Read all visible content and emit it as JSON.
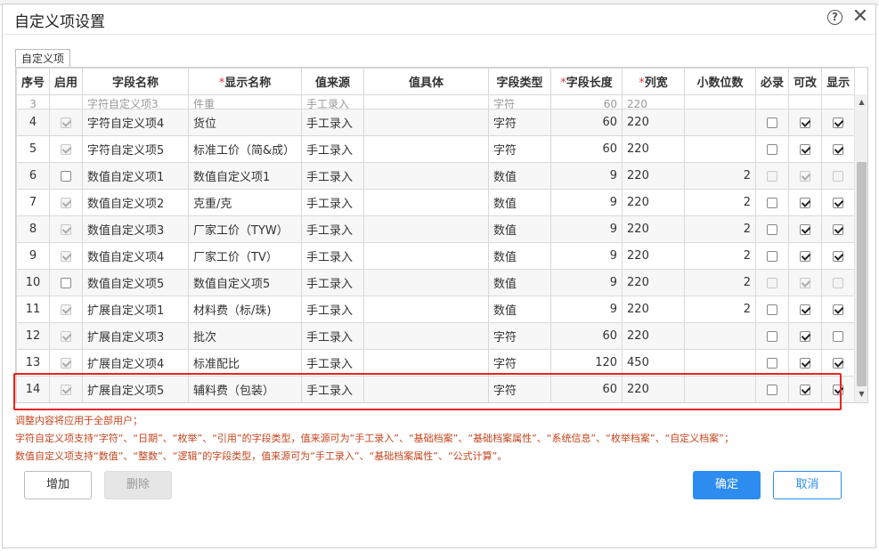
{
  "dialog": {
    "title": "自定义项设置",
    "tab": "自定义项"
  },
  "columns": [
    {
      "label": "序号",
      "required": false
    },
    {
      "label": "启用",
      "required": false
    },
    {
      "label": "字段名称",
      "required": false
    },
    {
      "label": "显示名称",
      "required": true
    },
    {
      "label": "值来源",
      "required": false
    },
    {
      "label": "值具体",
      "required": false
    },
    {
      "label": "字段类型",
      "required": false
    },
    {
      "label": "字段长度",
      "required": true
    },
    {
      "label": "列宽",
      "required": true
    },
    {
      "label": "小数位数",
      "required": false
    },
    {
      "label": "必录",
      "required": false
    },
    {
      "label": "可改",
      "required": false
    },
    {
      "label": "显示",
      "required": false
    }
  ],
  "partial_row": {
    "seq": "3",
    "field": "字符自定义项3",
    "display": "件重",
    "source": "手工录入",
    "type": "字符",
    "length": "60",
    "width": "220"
  },
  "rows": [
    {
      "seq": "4",
      "enabled": true,
      "enabled_disabled": true,
      "field": "字符自定义项4",
      "display": "货位",
      "source": "手工录入",
      "detail": "",
      "type": "字符",
      "length": "60",
      "width": "220",
      "decimals": "",
      "required": false,
      "required_disabled": false,
      "editable": true,
      "editable_disabled": false,
      "visible": true,
      "visible_disabled": false
    },
    {
      "seq": "5",
      "enabled": true,
      "enabled_disabled": true,
      "field": "字符自定义项5",
      "display": "标准工价（简&成）",
      "source": "手工录入",
      "detail": "",
      "type": "字符",
      "length": "60",
      "width": "220",
      "decimals": "",
      "required": false,
      "required_disabled": false,
      "editable": true,
      "editable_disabled": false,
      "visible": true,
      "visible_disabled": false
    },
    {
      "seq": "6",
      "enabled": false,
      "enabled_disabled": false,
      "field": "数值自定义项1",
      "display": "数值自定义项1",
      "source": "手工录入",
      "detail": "",
      "type": "数值",
      "length": "9",
      "width": "220",
      "decimals": "2",
      "required": false,
      "required_disabled": true,
      "editable": true,
      "editable_disabled": true,
      "visible": false,
      "visible_disabled": true
    },
    {
      "seq": "7",
      "enabled": true,
      "enabled_disabled": true,
      "field": "数值自定义项2",
      "display": "克重/克",
      "source": "手工录入",
      "detail": "",
      "type": "数值",
      "length": "9",
      "width": "220",
      "decimals": "2",
      "required": false,
      "required_disabled": false,
      "editable": true,
      "editable_disabled": false,
      "visible": true,
      "visible_disabled": false
    },
    {
      "seq": "8",
      "enabled": true,
      "enabled_disabled": true,
      "field": "数值自定义项3",
      "display": "厂家工价（TYW）",
      "source": "手工录入",
      "detail": "",
      "type": "数值",
      "length": "9",
      "width": "220",
      "decimals": "2",
      "required": false,
      "required_disabled": false,
      "editable": true,
      "editable_disabled": false,
      "visible": true,
      "visible_disabled": false
    },
    {
      "seq": "9",
      "enabled": true,
      "enabled_disabled": true,
      "field": "数值自定义项4",
      "display": "厂家工价（TV）",
      "source": "手工录入",
      "detail": "",
      "type": "数值",
      "length": "9",
      "width": "220",
      "decimals": "2",
      "required": false,
      "required_disabled": false,
      "editable": true,
      "editable_disabled": false,
      "visible": true,
      "visible_disabled": false
    },
    {
      "seq": "10",
      "enabled": false,
      "enabled_disabled": false,
      "field": "数值自定义项5",
      "display": "数值自定义项5",
      "source": "手工录入",
      "detail": "",
      "type": "数值",
      "length": "9",
      "width": "220",
      "decimals": "2",
      "required": false,
      "required_disabled": true,
      "editable": true,
      "editable_disabled": true,
      "visible": false,
      "visible_disabled": true
    },
    {
      "seq": "11",
      "enabled": true,
      "enabled_disabled": true,
      "field": "扩展自定义项1",
      "display": "材料费（标/珠)",
      "source": "手工录入",
      "detail": "",
      "type": "数值",
      "length": "9",
      "width": "220",
      "decimals": "2",
      "required": false,
      "required_disabled": false,
      "editable": true,
      "editable_disabled": false,
      "visible": true,
      "visible_disabled": false
    },
    {
      "seq": "12",
      "enabled": true,
      "enabled_disabled": true,
      "field": "扩展自定义项3",
      "display": "批次",
      "source": "手工录入",
      "detail": "",
      "type": "字符",
      "length": "60",
      "width": "220",
      "decimals": "",
      "required": false,
      "required_disabled": false,
      "editable": true,
      "editable_disabled": false,
      "visible": false,
      "visible_disabled": false
    },
    {
      "seq": "13",
      "enabled": true,
      "enabled_disabled": true,
      "field": "扩展自定义项4",
      "display": "标准配比",
      "source": "手工录入",
      "detail": "",
      "type": "字符",
      "length": "120",
      "width": "450",
      "decimals": "",
      "required": false,
      "required_disabled": false,
      "editable": true,
      "editable_disabled": false,
      "visible": true,
      "visible_disabled": false
    },
    {
      "seq": "14",
      "enabled": true,
      "enabled_disabled": true,
      "field": "扩展自定义项5",
      "display": "辅料费（包装）",
      "source": "手工录入",
      "detail": "",
      "type": "字符",
      "length": "60",
      "width": "220",
      "decimals": "",
      "required": false,
      "required_disabled": false,
      "editable": true,
      "editable_disabled": false,
      "visible": true,
      "visible_disabled": false
    }
  ],
  "notes": [
    "调整内容将应用于全部用户；",
    "字符自定义项支持“字符”、“日期”、“枚举”、“引用”的字段类型，值来源可为“手工录入”、“基础档案”、“基础档案属性”、“系统信息”、“枚举档案”、“自定义档案”；",
    "数值自定义项支持“数值”、“整数”、“逻辑”的字段类型，值来源可为“手工录入”、“基础档案属性”、“公式计算”。"
  ],
  "buttons": {
    "add": "增加",
    "delete": "删除",
    "ok": "确定",
    "cancel": "取消"
  },
  "colors": {
    "primary": "#2d8cf0",
    "highlight": "#e8231f",
    "note": "#c6441c",
    "required_star": "#e4393c"
  }
}
